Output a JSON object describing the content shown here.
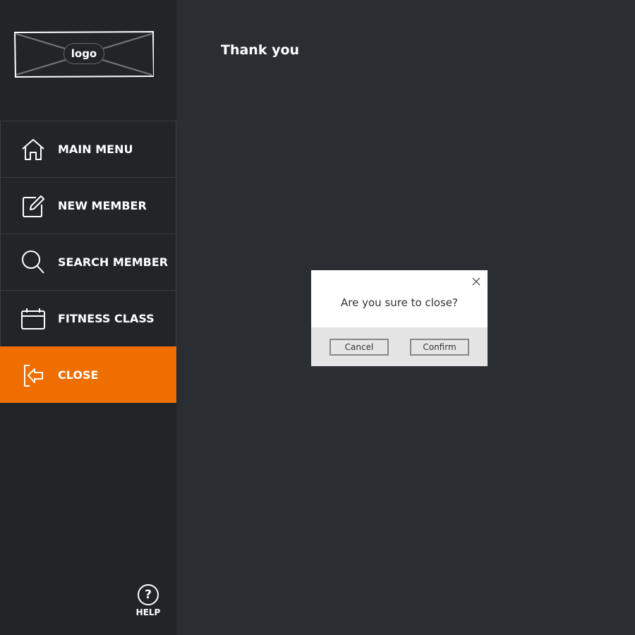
{
  "logo": {
    "label": "logo"
  },
  "nav": {
    "items": [
      {
        "label": "MAIN MENU",
        "icon": "home-icon"
      },
      {
        "label": "NEW MEMBER",
        "icon": "edit-icon"
      },
      {
        "label": "SEARCH MEMBER",
        "icon": "search-icon"
      },
      {
        "label": "FITNESS CLASS",
        "icon": "calendar-icon"
      },
      {
        "label": "CLOSE",
        "icon": "exit-icon",
        "active": true
      }
    ]
  },
  "help": {
    "icon_glyph": "?",
    "label": "HELP"
  },
  "main": {
    "heading": "Thank you"
  },
  "dialog": {
    "message": "Are you sure to close?",
    "cancel_label": "Cancel",
    "confirm_label": "Confirm"
  },
  "colors": {
    "accent": "#ee6e00",
    "sidebar_bg": "#222428",
    "main_bg": "#2a2d32"
  }
}
